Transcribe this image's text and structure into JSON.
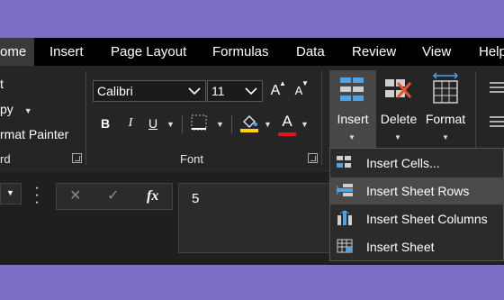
{
  "tabs": [
    {
      "label": "ome",
      "active": true
    },
    {
      "label": "Insert"
    },
    {
      "label": "Page Layout"
    },
    {
      "label": "Formulas"
    },
    {
      "label": "Data"
    },
    {
      "label": "Review"
    },
    {
      "label": "View"
    },
    {
      "label": "Help"
    }
  ],
  "clipboard": {
    "items": [
      "t",
      "py",
      "rmat Painter"
    ],
    "group_label": "rd"
  },
  "font": {
    "name": "Calibri",
    "size": "11",
    "group_label": "Font",
    "bold": "B",
    "italic": "I",
    "underline": "U",
    "grow": "A",
    "shrink": "A",
    "font_color": "A"
  },
  "cells": {
    "insert_label": "Insert",
    "delete_label": "Delete",
    "format_label": "Format"
  },
  "formula_bar": {
    "cancel": "✕",
    "enter": "✓",
    "fx": "fx",
    "value": "5"
  },
  "insert_menu": {
    "items": [
      {
        "label": "Insert Cells...",
        "icon": "insert-cells-icon"
      },
      {
        "label": "Insert Sheet Rows",
        "icon": "insert-sheet-rows-icon",
        "highlighted": true
      },
      {
        "label": "Insert Sheet Columns",
        "icon": "insert-sheet-columns-icon"
      },
      {
        "label": "Insert Sheet",
        "icon": "insert-sheet-icon"
      }
    ]
  },
  "colors": {
    "background": "#7b6ec4",
    "ribbon": "#252525",
    "font_color_bar": "#e81123",
    "highlight_bar": "#ffd400",
    "icon_blue": "#4ea3e6"
  }
}
